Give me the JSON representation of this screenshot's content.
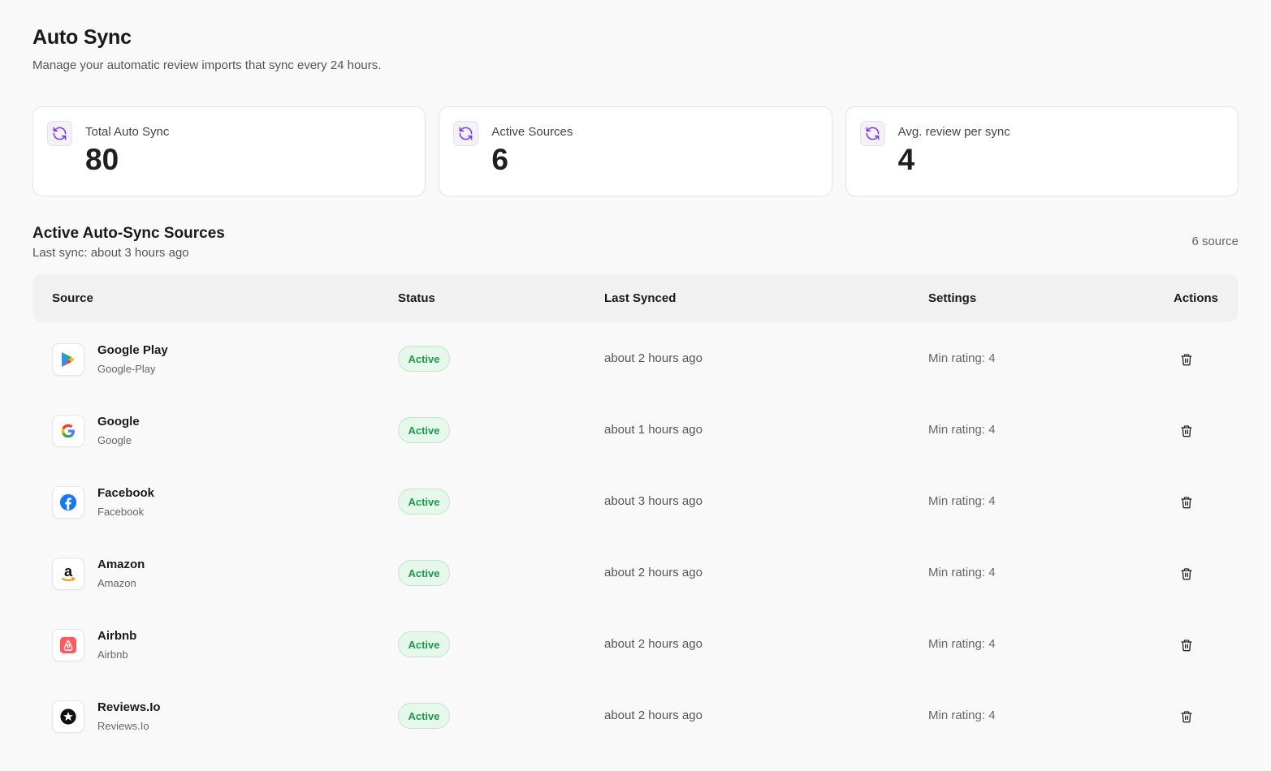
{
  "header": {
    "title": "Auto Sync",
    "subtitle": "Manage your automatic review imports that sync every 24 hours."
  },
  "stats": [
    {
      "label": "Total Auto Sync",
      "value": "80",
      "icon": "refresh-icon"
    },
    {
      "label": "Active Sources",
      "value": "6",
      "icon": "refresh-icon"
    },
    {
      "label": "Avg. review per sync",
      "value": "4",
      "icon": "refresh-icon"
    }
  ],
  "section": {
    "title": "Active Auto-Sync Sources",
    "last_sync": "Last sync: about 3 hours ago",
    "count": "6 source"
  },
  "table": {
    "columns": [
      "Source",
      "Status",
      "Last Synced",
      "Settings",
      "Actions"
    ],
    "rows": [
      {
        "name": "Google Play",
        "slug": "Google-Play",
        "icon": "google-play-icon",
        "status": "Active",
        "last_synced": "about 2 hours ago",
        "settings": "Min rating: 4"
      },
      {
        "name": "Google",
        "slug": "Google",
        "icon": "google-icon",
        "status": "Active",
        "last_synced": "about 1 hours ago",
        "settings": "Min rating: 4"
      },
      {
        "name": "Facebook",
        "slug": "Facebook",
        "icon": "facebook-icon",
        "status": "Active",
        "last_synced": "about 3 hours ago",
        "settings": "Min rating: 4"
      },
      {
        "name": "Amazon",
        "slug": "Amazon",
        "icon": "amazon-icon",
        "status": "Active",
        "last_synced": "about 2 hours ago",
        "settings": "Min rating: 4"
      },
      {
        "name": "Airbnb",
        "slug": "Airbnb",
        "icon": "airbnb-icon",
        "status": "Active",
        "last_synced": "about 2 hours ago",
        "settings": "Min rating: 4"
      },
      {
        "name": "Reviews.Io",
        "slug": "Reviews.Io",
        "icon": "reviews-io-icon",
        "status": "Active",
        "last_synced": "about 2 hours ago",
        "settings": "Min rating: 4"
      }
    ]
  },
  "colors": {
    "accent": "#7c3aed",
    "active_badge_bg": "#e6f7ec",
    "active_badge_text": "#1c9a4a",
    "page_bg": "#f9f9f9"
  }
}
